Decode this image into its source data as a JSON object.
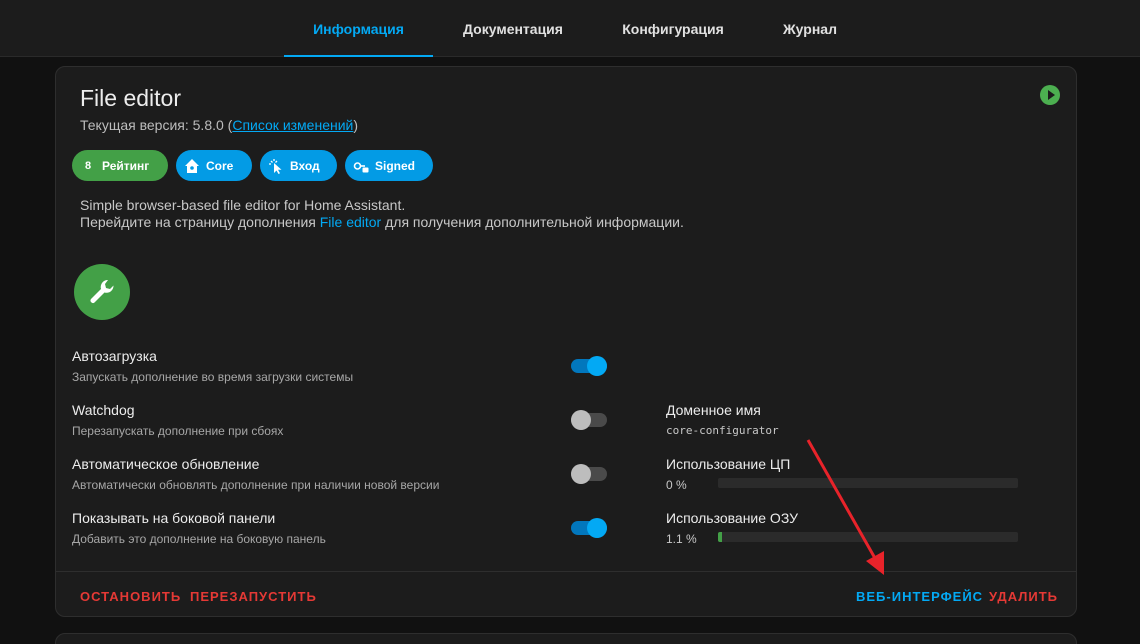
{
  "tabs": [
    {
      "label": "Информация",
      "active": true
    },
    {
      "label": "Документация",
      "active": false
    },
    {
      "label": "Конфигурация",
      "active": false
    },
    {
      "label": "Журнал",
      "active": false
    }
  ],
  "addon": {
    "title": "File editor",
    "version_prefix": "Текущая версия: 5.8.0 (",
    "changelog_link": "Список изменений",
    "version_suffix": ")"
  },
  "chips": [
    {
      "icon": "8",
      "label": "Рейтинг",
      "color": "#43a047"
    },
    {
      "icon": "home-assistant-icon",
      "label": "Core",
      "color": "#039be5"
    },
    {
      "icon": "cursor-click-icon",
      "label": "Вход",
      "color": "#039be5"
    },
    {
      "icon": "key-lock-icon",
      "label": "Signed",
      "color": "#039be5"
    }
  ],
  "description": {
    "line1": "Simple browser-based file editor for Home Assistant.",
    "line2_prefix": "Перейдите на страницу дополнения ",
    "line2_link": "File editor",
    "line2_suffix": " для получения дополнительной информации."
  },
  "options": [
    {
      "title": "Автозагрузка",
      "subtitle": "Запускать дополнение во время загрузки системы",
      "enabled": true
    },
    {
      "title": "Watchdog",
      "subtitle": "Перезапускать дополнение при сбоях",
      "enabled": false
    },
    {
      "title": "Автоматическое обновление",
      "subtitle": "Автоматически обновлять дополнение при наличии новой версии",
      "enabled": false
    },
    {
      "title": "Показывать на боковой панели",
      "subtitle": "Добавить это дополнение на боковую панель",
      "enabled": true
    }
  ],
  "info": {
    "hostname_label": "Доменное имя",
    "hostname_value": "core-configurator",
    "cpu_label": "Использование ЦП",
    "cpu_value": "0 %",
    "cpu_fraction": 0,
    "ram_label": "Использование ОЗУ",
    "ram_value": "1.1 %",
    "ram_fraction": 0.011
  },
  "actions": {
    "stop": "ОСТАНОВИТЬ",
    "restart": "ПЕРЕЗАПУСТИТЬ",
    "web_ui": "ВЕБ-ИНТЕРФЕЙС",
    "uninstall": "УДАЛИТЬ"
  },
  "colors": {
    "accent": "#03a9f4",
    "success": "#43a047",
    "danger": "#e53935",
    "annotation_arrow": "#e8232a"
  }
}
